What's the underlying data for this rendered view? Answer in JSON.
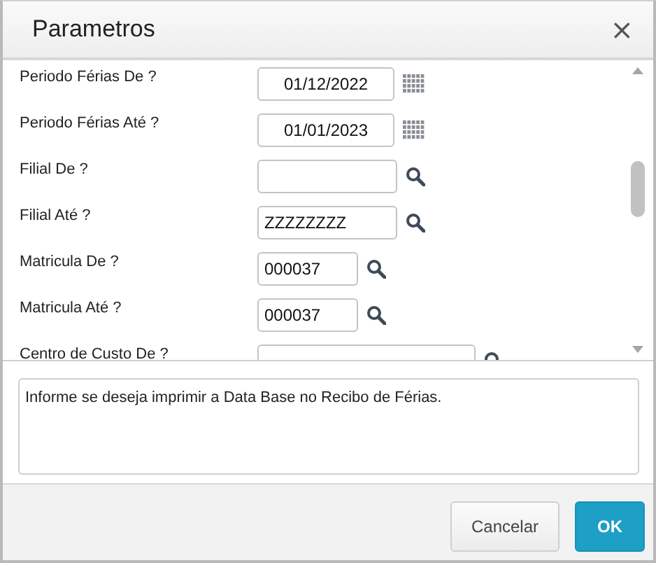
{
  "window": {
    "title": "Parametros",
    "close": "×"
  },
  "parameters": [
    {
      "label": "Periodo Férias De ?",
      "value": "01/12/2022",
      "kind": "date"
    },
    {
      "label": "Periodo Férias Até ?",
      "value": "01/01/2023",
      "kind": "date"
    },
    {
      "label": "Filial De ?",
      "kind": "lookup"
    },
    {
      "label": "Filial Até ?",
      "value": "ZZZZZZZZ",
      "kind": "lookup"
    },
    {
      "label": "Matricula De ?",
      "value": "000037",
      "kind": "lookup"
    },
    {
      "label": "Matricula Até ?",
      "value": "000037",
      "kind": "lookup"
    },
    {
      "label": "Centro de Custo De ?",
      "kind": "lookup"
    }
  ],
  "help": {
    "text": "Informe se deseja imprimir a Data Base no Recibo de Férias."
  },
  "buttons": [
    {
      "label": "Cancelar",
      "kind": "secondary"
    },
    {
      "label": "OK",
      "kind": "primary"
    }
  ]
}
